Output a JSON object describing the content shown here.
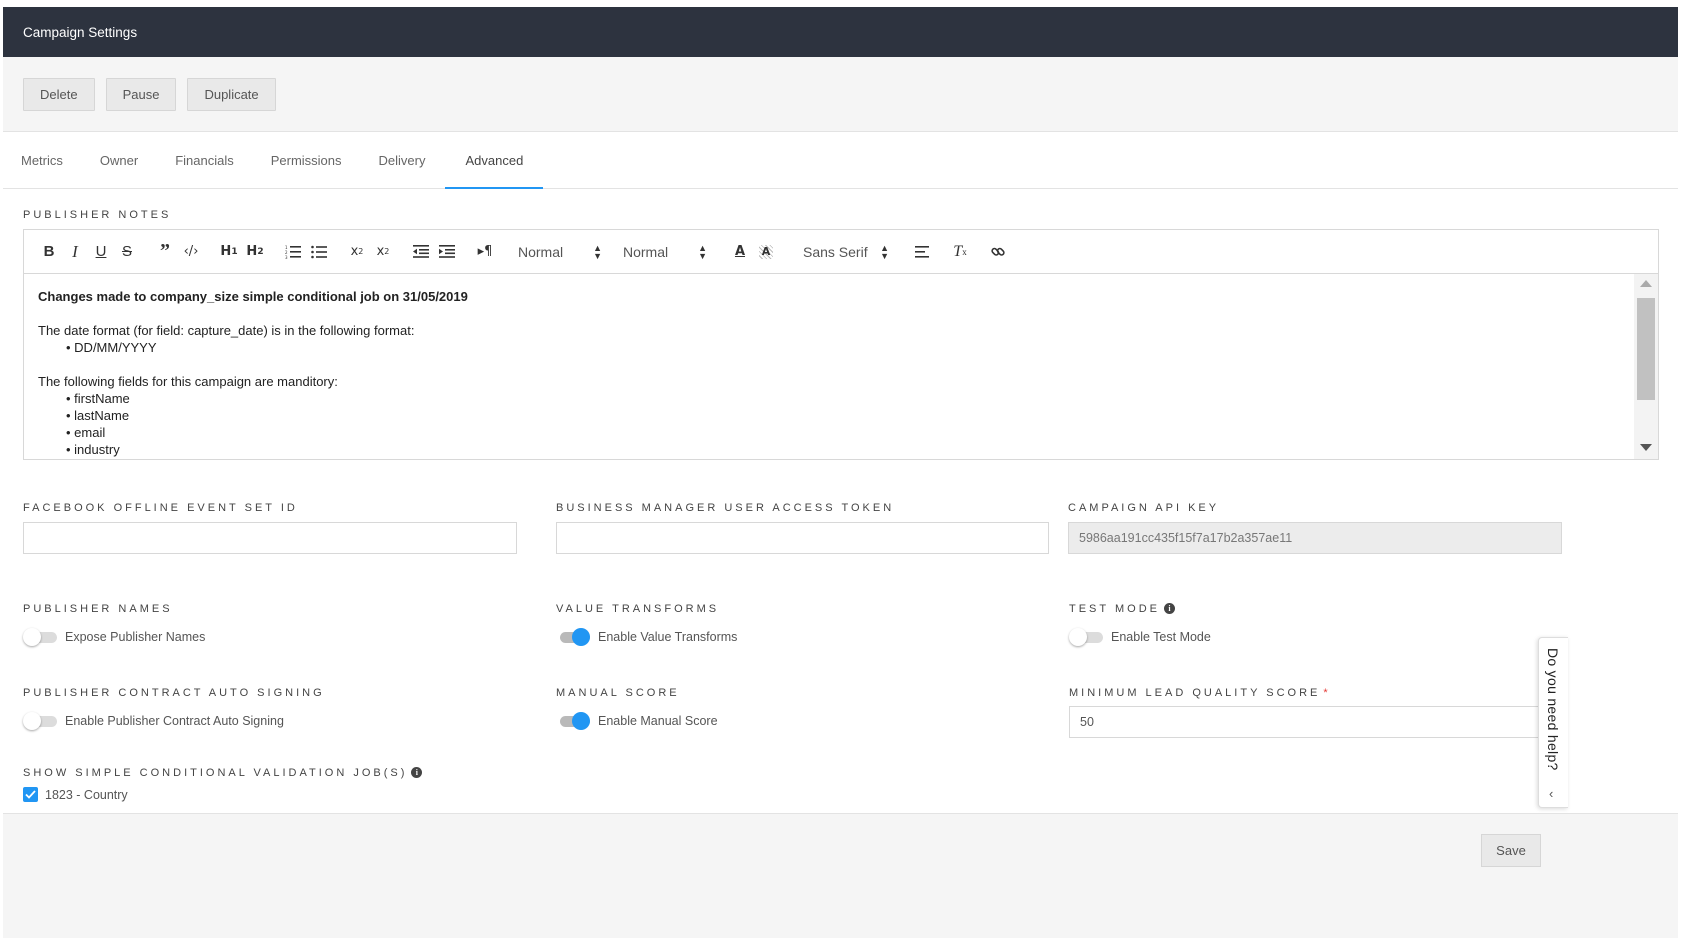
{
  "header": {
    "title": "Campaign Settings"
  },
  "actions": {
    "delete": "Delete",
    "pause": "Pause",
    "duplicate": "Duplicate"
  },
  "tabs": [
    {
      "label": "Metrics"
    },
    {
      "label": "Owner"
    },
    {
      "label": "Financials"
    },
    {
      "label": "Permissions"
    },
    {
      "label": "Delivery"
    },
    {
      "label": "Advanced",
      "active": true
    }
  ],
  "publisher_notes": {
    "label": "Publisher Notes",
    "toolbar": {
      "header_picker": "Normal",
      "size_picker": "Normal",
      "font_picker": "Sans Serif",
      "icons": [
        "bold-icon",
        "italic-icon",
        "underline-icon",
        "strike-icon",
        "blockquote-icon",
        "code-block-icon",
        "header-1-icon",
        "header-2-icon",
        "ordered-list-icon",
        "bullet-list-icon",
        "subscript-icon",
        "superscript-icon",
        "outdent-icon",
        "indent-icon",
        "text-direction-icon",
        "text-color-icon",
        "background-color-icon",
        "align-icon",
        "clean-format-icon",
        "link-icon"
      ]
    },
    "content": {
      "heading": "Changes made to company_size simple conditional job on 31/05/2019",
      "date_line": "The date format (for field: capture_date) is in the following format:",
      "date_items": [
        "DD/MM/YYYY"
      ],
      "fields_line": "The following fields for this campaign are manditory:",
      "field_items": [
        "firstName",
        "lastName",
        "email",
        "industry"
      ]
    }
  },
  "fields": {
    "facebook_offline": {
      "label": "Facebook Offline Event Set ID",
      "value": ""
    },
    "bm_token": {
      "label": "Business Manager User Access Token",
      "value": ""
    },
    "api_key": {
      "label": "Campaign API Key",
      "value": "5986aa191cc435f15f7a17b2a357ae11"
    },
    "min_lead_score": {
      "label": "Minimum Lead Quality Score",
      "required_mark": "*",
      "value": "50"
    }
  },
  "toggles": {
    "publisher_names": {
      "label": "Publisher Names",
      "text": "Expose Publisher Names",
      "on": false
    },
    "value_transforms": {
      "label": "Value Transforms",
      "text": "Enable Value Transforms",
      "on": true
    },
    "test_mode": {
      "label": "Test Mode",
      "text": "Enable Test Mode",
      "on": false
    },
    "contract_signing": {
      "label": "Publisher Contract Auto Signing",
      "text": "Enable Publisher Contract Auto Signing",
      "on": false
    },
    "manual_score": {
      "label": "Manual Score",
      "text": "Enable Manual Score",
      "on": true
    }
  },
  "validation_jobs": {
    "label": "Show Simple Conditional Validation Job(s)",
    "items": [
      {
        "label": "1823 - Country",
        "checked": true
      }
    ]
  },
  "footer": {
    "save": "Save"
  },
  "help": {
    "text": "Do you need help?"
  },
  "colors": {
    "header_bg": "#2d333f",
    "accent": "#2196f3",
    "required": "#e53935"
  }
}
